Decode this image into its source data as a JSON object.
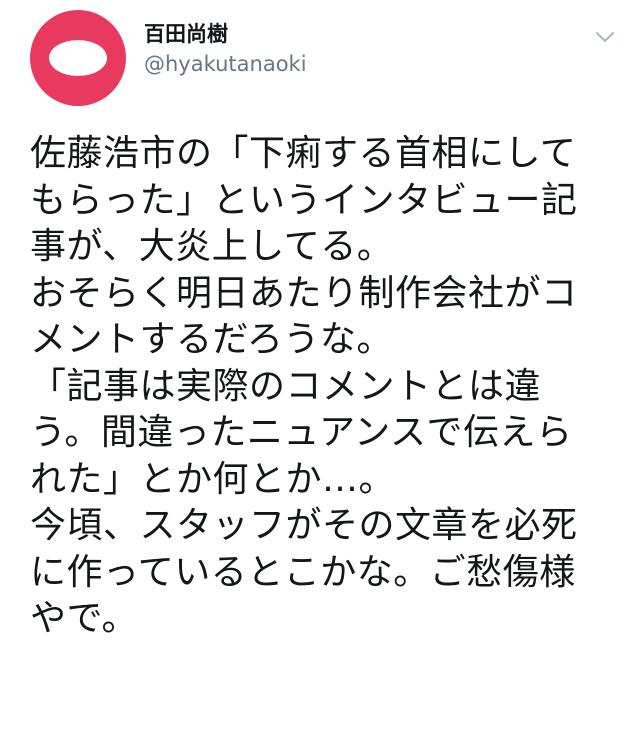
{
  "author": {
    "display_name": "百田尚樹",
    "handle": "@hyakutanaoki",
    "avatar_color": "#e8395f"
  },
  "menu": {
    "icon": "chevron-down-icon"
  },
  "tweet": {
    "lines": [
      "佐藤浩市の「下痢する首相にして",
      "もらった」というインタビュー記",
      "事が、大炎上してる。",
      "おそらく明日あたり制作会社がコ",
      "メントするだろうな。",
      "「記事は実際のコメントとは違",
      "う。間違ったニュアンスで伝えら",
      "れた」とか何とか…。",
      "今頃、スタッフがその文章を必死",
      "に作っているとこかな。ご愁傷様",
      "やで。"
    ]
  }
}
